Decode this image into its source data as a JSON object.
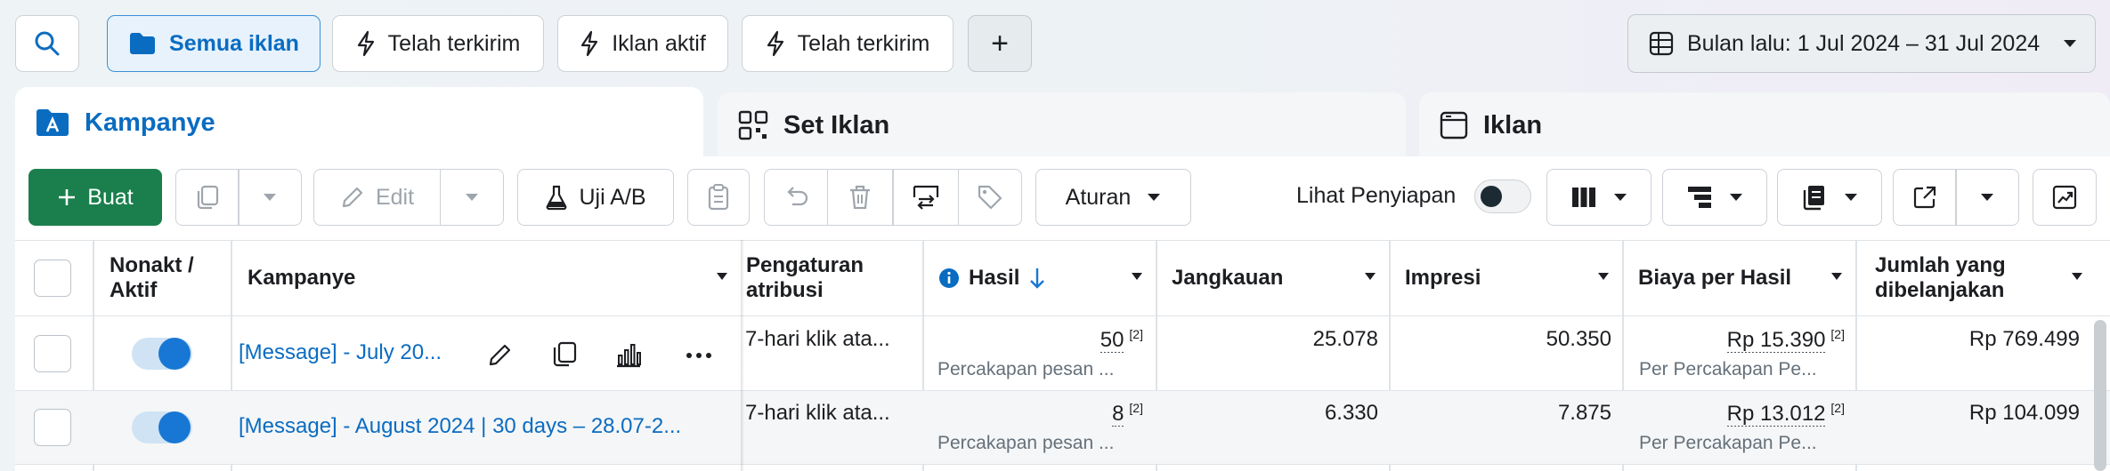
{
  "filters": {
    "all_ads": "Semua iklan",
    "sent_1": "Telah terkirim",
    "active_ads": "Iklan aktif",
    "sent_2": "Telah terkirim",
    "add": "+",
    "date_range": "Bulan lalu: 1 Jul 2024 – 31 Jul 2024"
  },
  "tabs": {
    "campaigns": "Kampanye",
    "ad_sets": "Set Iklan",
    "ads": "Iklan"
  },
  "toolbar": {
    "create": "Buat",
    "edit": "Edit",
    "ab_test": "Uji A/B",
    "rules": "Aturan",
    "view_setup": "Lihat Penyiapan"
  },
  "columns": {
    "status": "Nonakt / Aktif",
    "campaign": "Kampanye",
    "attribution": "Pengaturan atribusi",
    "results": "Hasil",
    "reach": "Jangkauan",
    "impressions": "Impresi",
    "cost_per_result": "Biaya per Hasil",
    "amount_spent": "Jumlah yang dibelanjakan"
  },
  "rows": [
    {
      "name": "[Message] - July 20...",
      "attribution": "7-hari klik ata...",
      "results": "50",
      "results_note": "[2]",
      "results_sub": "Percakapan pesan ...",
      "reach": "25.078",
      "impressions": "50.350",
      "cost": "Rp 15.390",
      "cost_note": "[2]",
      "cost_sub": "Per Percakapan Pe...",
      "spent": "Rp 769.499"
    },
    {
      "name": "[Message] - August 2024 | 30 days – 28.07-2...",
      "attribution": "7-hari klik ata...",
      "results": "8",
      "results_note": "[2]",
      "results_sub": "Percakapan pesan ...",
      "reach": "6.330",
      "impressions": "7.875",
      "cost": "Rp 13.012",
      "cost_note": "[2]",
      "cost_sub": "Per Percakapan Pe...",
      "spent": "Rp 104.099"
    }
  ],
  "colors": {
    "accent": "#0a6cc1",
    "create_green": "#1a7f4c",
    "toggle_on": "#1877d4"
  }
}
